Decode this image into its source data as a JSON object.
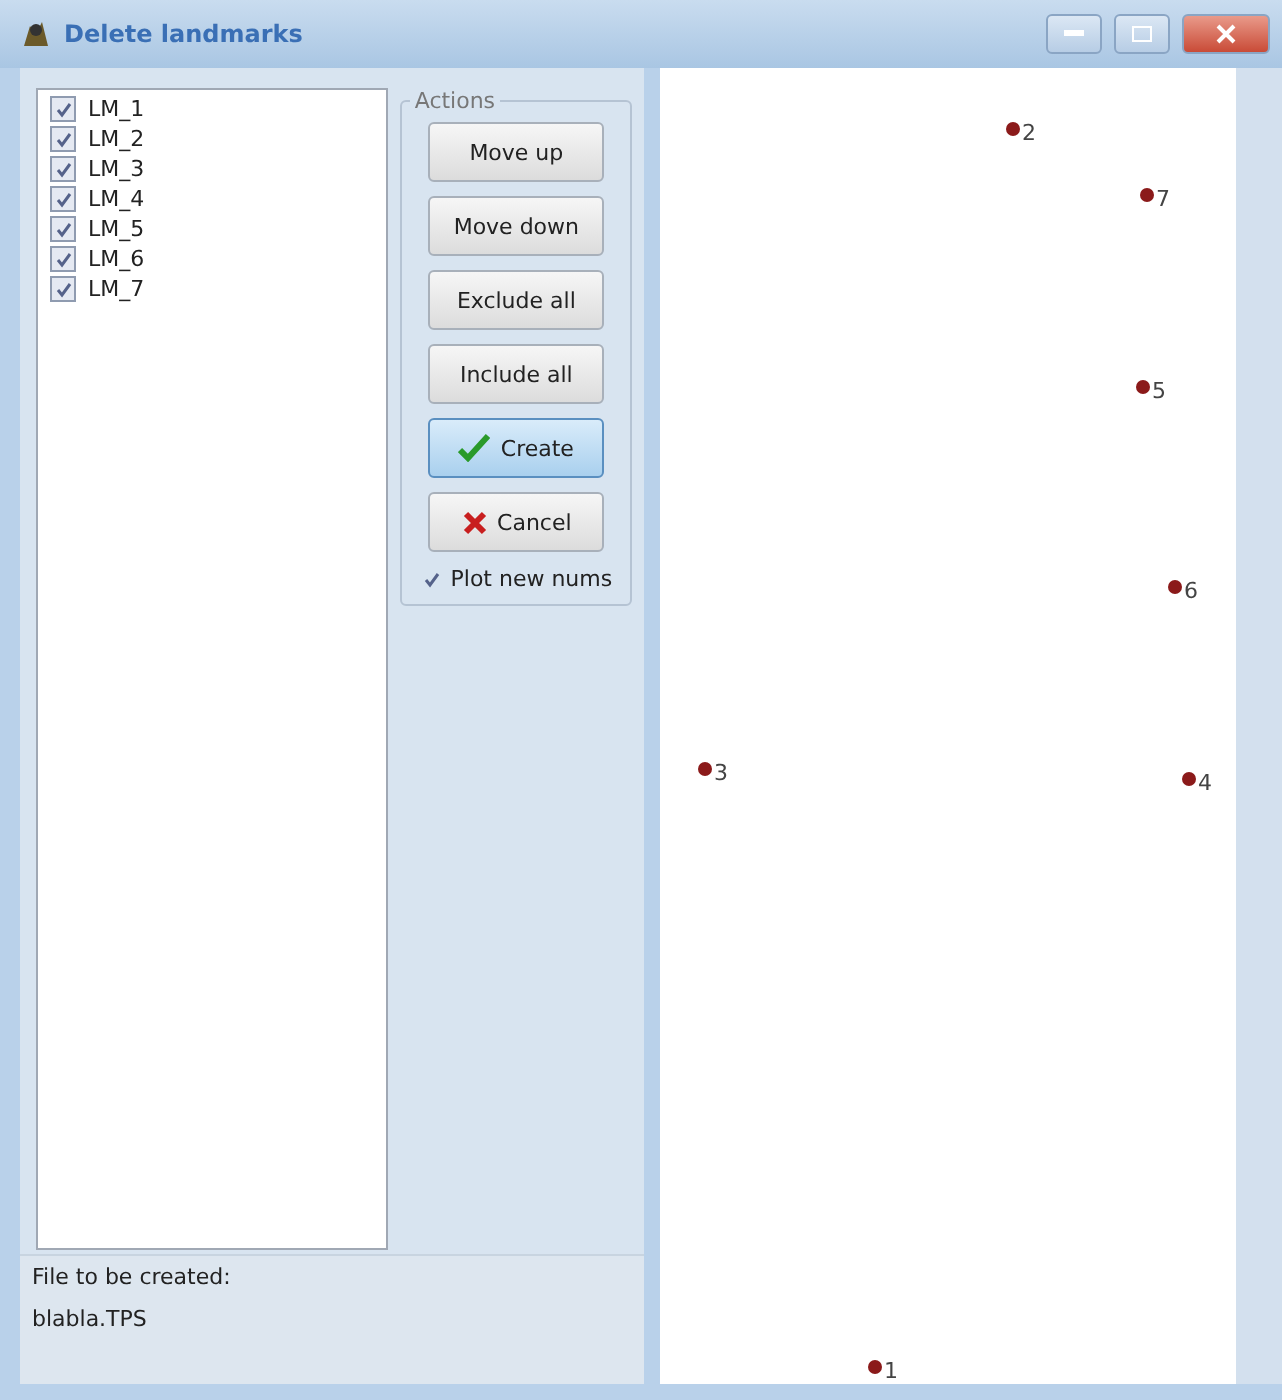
{
  "window": {
    "title": "Delete landmarks"
  },
  "landmarks": [
    {
      "label": "LM_1",
      "checked": true
    },
    {
      "label": "LM_2",
      "checked": true
    },
    {
      "label": "LM_3",
      "checked": true
    },
    {
      "label": "LM_4",
      "checked": true
    },
    {
      "label": "LM_5",
      "checked": true
    },
    {
      "label": "LM_6",
      "checked": true
    },
    {
      "label": "LM_7",
      "checked": true
    }
  ],
  "actions": {
    "title": "Actions",
    "buttons": [
      {
        "label": "Move up",
        "kind": "plain",
        "focused": false
      },
      {
        "label": "Move down",
        "kind": "plain",
        "focused": false
      },
      {
        "label": "Exclude all",
        "kind": "plain",
        "focused": false
      },
      {
        "label": "Include all",
        "kind": "plain",
        "focused": false
      },
      {
        "label": "Create",
        "kind": "create",
        "focused": true
      },
      {
        "label": "Cancel",
        "kind": "cancel",
        "focused": false
      }
    ],
    "plot_option": {
      "label": "Plot new nums",
      "checked": true
    }
  },
  "info": {
    "caption": "File to be created:",
    "file": "blabla.TPS"
  },
  "plot": {
    "points": [
      {
        "label": "1"
      },
      {
        "label": "2"
      },
      {
        "label": "3"
      },
      {
        "label": "4"
      },
      {
        "label": "5"
      },
      {
        "label": "6"
      },
      {
        "label": "7"
      }
    ]
  }
}
